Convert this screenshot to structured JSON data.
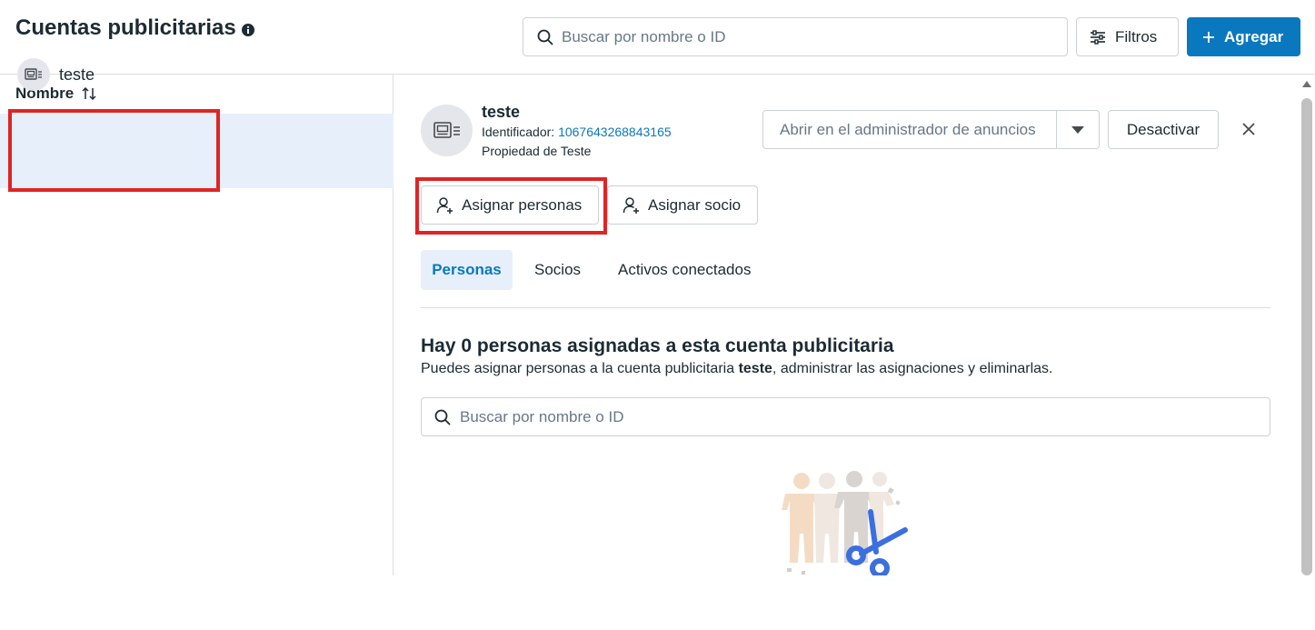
{
  "header": {
    "title": "Cuentas publicitarias",
    "search_placeholder": "Buscar por nombre o ID",
    "filters_label": "Filtros",
    "add_label": "Agregar"
  },
  "list": {
    "column_header": "Nombre",
    "items": [
      {
        "label": "teste",
        "selected": true
      }
    ]
  },
  "detail": {
    "name": "teste",
    "id_label": "Identificador: ",
    "id_value": "1067643268843165",
    "owner": "Propiedad de Teste",
    "open_label": "Abrir en el administrador de anuncios",
    "deactivate_label": "Desactivar",
    "assign_people_label": "Asignar personas",
    "assign_partner_label": "Asignar socio",
    "tabs": [
      {
        "label": "Personas",
        "active": true
      },
      {
        "label": "Socios",
        "active": false
      },
      {
        "label": "Activos conectados",
        "active": false
      }
    ],
    "empty_title": "Hay 0 personas asignadas a esta cuenta publicitaria",
    "empty_desc_before": "Puedes asignar personas a la cuenta publicitaria ",
    "empty_desc_bold": "teste",
    "empty_desc_after": ", administrar las asignaciones y eliminarlas.",
    "search_placeholder": "Buscar por nombre o ID"
  },
  "colors": {
    "accent": "#0a78be",
    "selected_bg": "#e7f0fa",
    "highlight": "#e02424"
  }
}
